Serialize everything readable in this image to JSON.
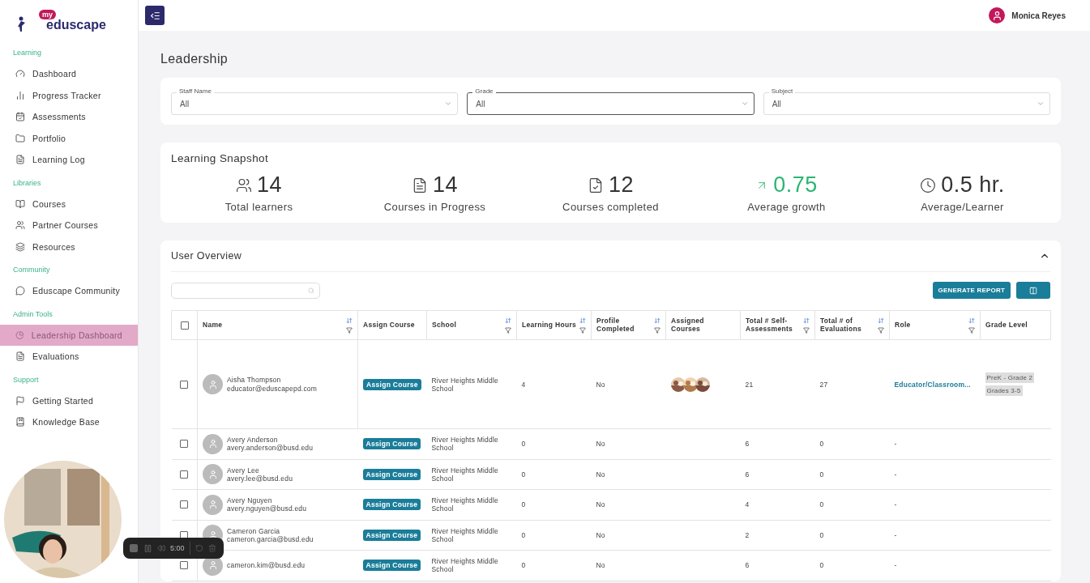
{
  "logo": {
    "badge": "my",
    "name": "eduscape"
  },
  "sidebar": {
    "sections": [
      {
        "title": "Learning",
        "items": [
          {
            "label": "Dashboard",
            "selected": false
          },
          {
            "label": "Progress Tracker",
            "selected": false
          },
          {
            "label": "Assessments",
            "selected": false
          },
          {
            "label": "Portfolio",
            "selected": false
          },
          {
            "label": "Learning Log",
            "selected": false
          }
        ]
      },
      {
        "title": "Libraries",
        "items": [
          {
            "label": "Courses",
            "selected": false
          },
          {
            "label": "Partner Courses",
            "selected": false
          },
          {
            "label": "Resources",
            "selected": false
          }
        ]
      },
      {
        "title": "Community",
        "items": [
          {
            "label": "Eduscape Community",
            "selected": false
          }
        ]
      },
      {
        "title": "Admin Tools",
        "items": [
          {
            "label": "Leadership Dashboard",
            "selected": true
          },
          {
            "label": "Evaluations",
            "selected": false
          }
        ]
      },
      {
        "title": "Support",
        "items": [
          {
            "label": "Getting Started",
            "selected": false
          },
          {
            "label": "Knowledge Base",
            "selected": false
          }
        ]
      }
    ]
  },
  "user": {
    "name": "Monica Reyes"
  },
  "page_title": "Leadership",
  "filters": [
    {
      "label": "Staff Name",
      "value": "All",
      "focused": false
    },
    {
      "label": "Grade",
      "value": "All",
      "focused": true
    },
    {
      "label": "Subject",
      "value": "All",
      "focused": false
    }
  ],
  "snapshot": {
    "title": "Learning Snapshot",
    "stats": [
      {
        "value": "14",
        "label": "Total learners",
        "kind": "plain"
      },
      {
        "value": "14",
        "label": "Courses in Progress",
        "kind": "plain"
      },
      {
        "value": "12",
        "label": "Courses completed",
        "kind": "plain"
      },
      {
        "value": "0.75",
        "label": "Average growth",
        "kind": "growth"
      },
      {
        "value": "0.5 hr.",
        "label": "Average/Learner",
        "kind": "plain"
      }
    ]
  },
  "overview": {
    "title": "User Overview",
    "expanded": true,
    "report_button": "GENERATE REPORT",
    "table": {
      "all_checked": false,
      "columns": [
        {
          "label": "Name",
          "sortable": true,
          "filterable": true
        },
        {
          "label": "Assign Course",
          "sortable": false,
          "filterable": false
        },
        {
          "label": "School",
          "sortable": true,
          "filterable": true
        },
        {
          "label": "Learning Hours",
          "sortable": true,
          "filterable": true
        },
        {
          "label": "Profile Completed",
          "sortable": true,
          "filterable": true
        },
        {
          "label": "Assigned Courses",
          "sortable": false,
          "filterable": false
        },
        {
          "label": "Total # Self-Assessments",
          "sortable": true,
          "filterable": true
        },
        {
          "label": "Total # of Evaluations",
          "sortable": true,
          "filterable": true
        },
        {
          "label": "Role",
          "sortable": true,
          "filterable": true
        },
        {
          "label": "Grade Level",
          "sortable": false,
          "filterable": false
        }
      ],
      "rows": [
        {
          "checked": false,
          "name": "Aisha Thompson",
          "email": "educator@eduscapepd.com",
          "assign": "Assign Course",
          "school": "River Heights Middle School",
          "hours": "4",
          "profile": "No",
          "assigned_courses": [
            {
              "kind": "picture"
            },
            {
              "kind": "picture"
            },
            {
              "kind": "picture"
            }
          ],
          "self": "21",
          "evals": "27",
          "role": "Educator/Classroom...",
          "grades": [
            "PreK - Grade 2",
            "Grades 3-5"
          ]
        },
        {
          "checked": false,
          "name": "Avery Anderson",
          "email": "avery.anderson@busd.edu",
          "assign": "Assign Course",
          "school": "River Heights Middle School",
          "hours": "0",
          "profile": "No",
          "self": "6",
          "evals": "0",
          "role": "-"
        },
        {
          "checked": false,
          "name": "Avery Lee",
          "email": "avery.lee@busd.edu",
          "assign": "Assign Course",
          "school": "River Heights Middle School",
          "hours": "0",
          "profile": "No",
          "self": "6",
          "evals": "0",
          "role": "-"
        },
        {
          "checked": false,
          "name": "Avery Nguyen",
          "email": "avery.nguyen@busd.edu",
          "assign": "Assign Course",
          "school": "River Heights Middle School",
          "hours": "0",
          "profile": "No",
          "self": "4",
          "evals": "0",
          "role": "-"
        },
        {
          "checked": false,
          "name": "Cameron Garcia",
          "email": "cameron.garcia@busd.edu",
          "assign": "Assign Course",
          "school": "River Heights Middle School",
          "hours": "0",
          "profile": "No",
          "self": "2",
          "evals": "0",
          "role": "-"
        },
        {
          "checked": false,
          "email": "cameron.kim@busd.edu",
          "assign": "Assign Course",
          "school": "River Heights Middle School",
          "hours": "0",
          "profile": "No",
          "self": "6",
          "evals": "0",
          "role": "-"
        }
      ]
    }
  },
  "recorder": {
    "time": "5:00"
  },
  "webcam": {
    "kind": "picture"
  }
}
